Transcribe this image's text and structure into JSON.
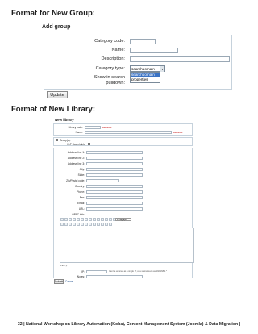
{
  "headings": {
    "new_group": "Format for New Group:",
    "new_library": "Format of New Library:"
  },
  "add_group": {
    "title": "Add group",
    "labels": {
      "category_code": "Category code:",
      "name": "Name:",
      "description": "Description:",
      "category_type": "Category type:",
      "show_in_search": "Show in search",
      "pulldown": "pulldown:"
    },
    "category_type_selected": "searchdomain",
    "category_type_options": [
      "searchdomain",
      "properties"
    ],
    "update_button": "Update"
  },
  "new_library": {
    "title": "New library",
    "labels": {
      "library_code": "Library code:",
      "name": "Name:",
      "groups": "Group(s):",
      "hlt_searchable": "HLT Searchable",
      "address1": "Address line 1:",
      "address2": "Address line 2:",
      "address3": "Address line 3:",
      "city": "City:",
      "state": "State:",
      "zip": "Zip/Postal code:",
      "country": "Country:",
      "phone": "Phone:",
      "fax": "Fax:",
      "email": "Email:",
      "url": "URL:",
      "opac_info": "OPAC info:",
      "path": "Path: p",
      "ip": "IP:",
      "notes": "Notes:"
    },
    "required": "Required",
    "paragraph_select": "Paragraph",
    "ip_hint": "Can be entered as a single IP, or a subnet such as 192.168.1.*",
    "submit_button": "Submit",
    "cancel_link": "Cancel"
  },
  "footer": {
    "text": "32 | National Workshop on Library Automation (Koha), Content Management System (Joomla) & Data Migration |"
  }
}
